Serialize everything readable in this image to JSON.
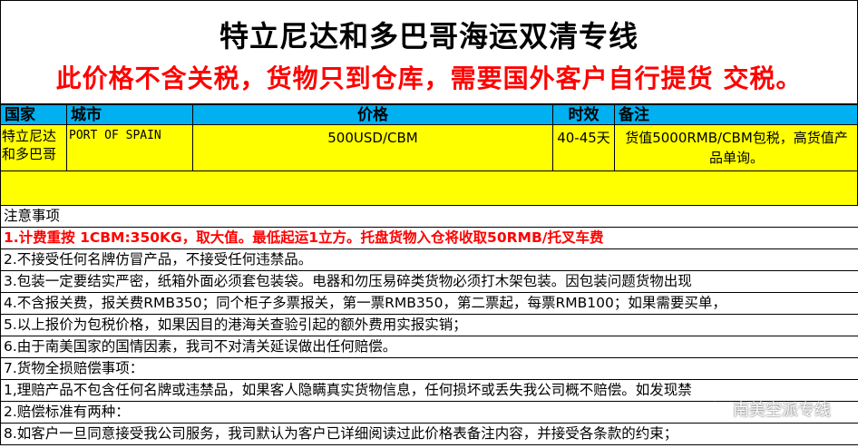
{
  "title": "特立尼达和多巴哥海运双清专线",
  "subtitle": "此价格不含关税，货物只到仓库，需要国外客户自行提货 交税。",
  "table": {
    "headers": {
      "country": "国家",
      "city": "城市",
      "price": "价格",
      "time": "时效",
      "remark": "备注"
    },
    "row": {
      "country": "特立尼达和多巴哥",
      "city": "PORT OF SPAIN",
      "price": "500USD/CBM",
      "time": "40-45天",
      "remark": "货值5000RMB/CBM包税，高货值产品单询。"
    }
  },
  "notes_title": "注意事项",
  "notes": [
    "1.计费重按 1CBM:350KG，取大值。最低起运1立方。托盘货物入仓将收取50RMB/托叉车费",
    "2.不接受任何名牌仿冒产品，不接受任何违禁品。",
    "3.包装一定要结实严密，纸箱外面必须套包装袋。电器和勿压易碎类货物必须打木架包装。因包装问题货物出现",
    "4.不含报关费，报关费RMB350；同个柜子多票报关，第一票RMB350，第二票起，每票RMB100；如果需要买单，",
    "5.以上报价为包税价格，如果因目的港海关查验引起的额外费用实报实销；",
    "6.由于南美国家的国情因素，我司不对清关延误做出任何赔偿。",
    "7.货物全损赔偿事项：",
    "1,理赔产品不包含任何名牌或违禁品，如果客人隐瞒真实货物信息，任何损坏或丢失我公司概不赔偿。如发现禁",
    "2.赔偿标准有两种：",
    "8.如客户一旦同意接受我公司服务，我司默认为客户已详细阅读过此价格表备注内容，并接受各条款的约束；"
  ],
  "watermark": {
    "text": "南美空派专线",
    "icon": "wechat-icon"
  },
  "colors": {
    "header_bg": "#00b0f0",
    "row_bg": "#ffff00",
    "title_red": "#ff0000"
  }
}
